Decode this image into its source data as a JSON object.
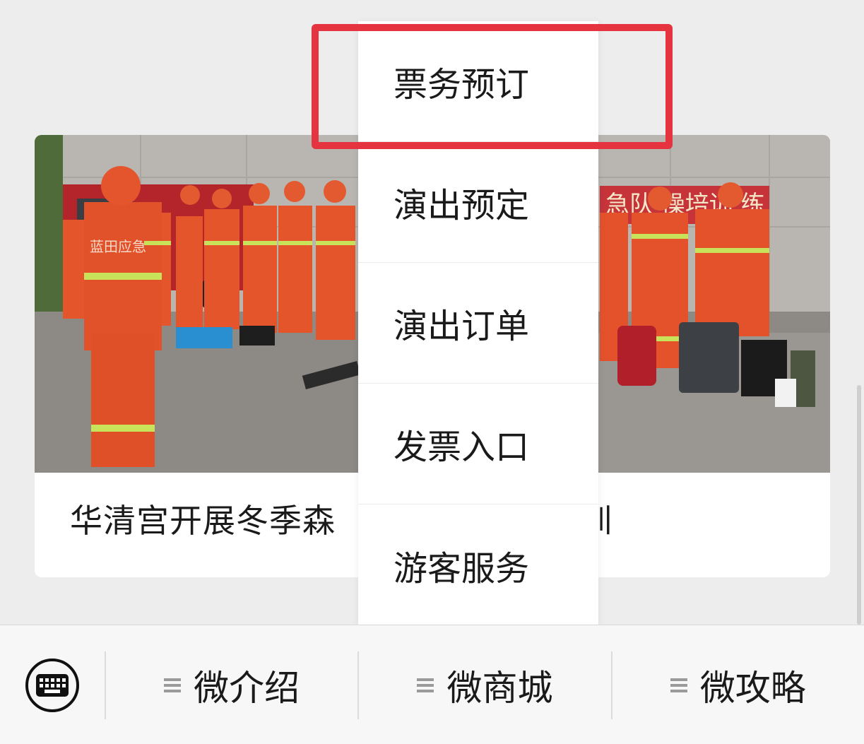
{
  "article": {
    "title": "华清宫开展冬季森",
    "title_tail": "训",
    "banner_text": "急队    操培训    练",
    "jacket_text": "蓝田应急"
  },
  "menu": {
    "items": [
      {
        "label": "票务预订"
      },
      {
        "label": "演出预定"
      },
      {
        "label": "演出订单"
      },
      {
        "label": "发票入口"
      },
      {
        "label": "游客服务"
      }
    ]
  },
  "bottom_bar": {
    "keyboard_icon": "keyboard-icon",
    "tabs": [
      {
        "label": "微介绍",
        "icon": "menu-icon"
      },
      {
        "label": "微商城",
        "icon": "menu-icon"
      },
      {
        "label": "微攻略",
        "icon": "menu-icon"
      }
    ]
  },
  "colors": {
    "highlight": "#e5343f",
    "uniform": "#e4522a",
    "background": "#ededed"
  }
}
